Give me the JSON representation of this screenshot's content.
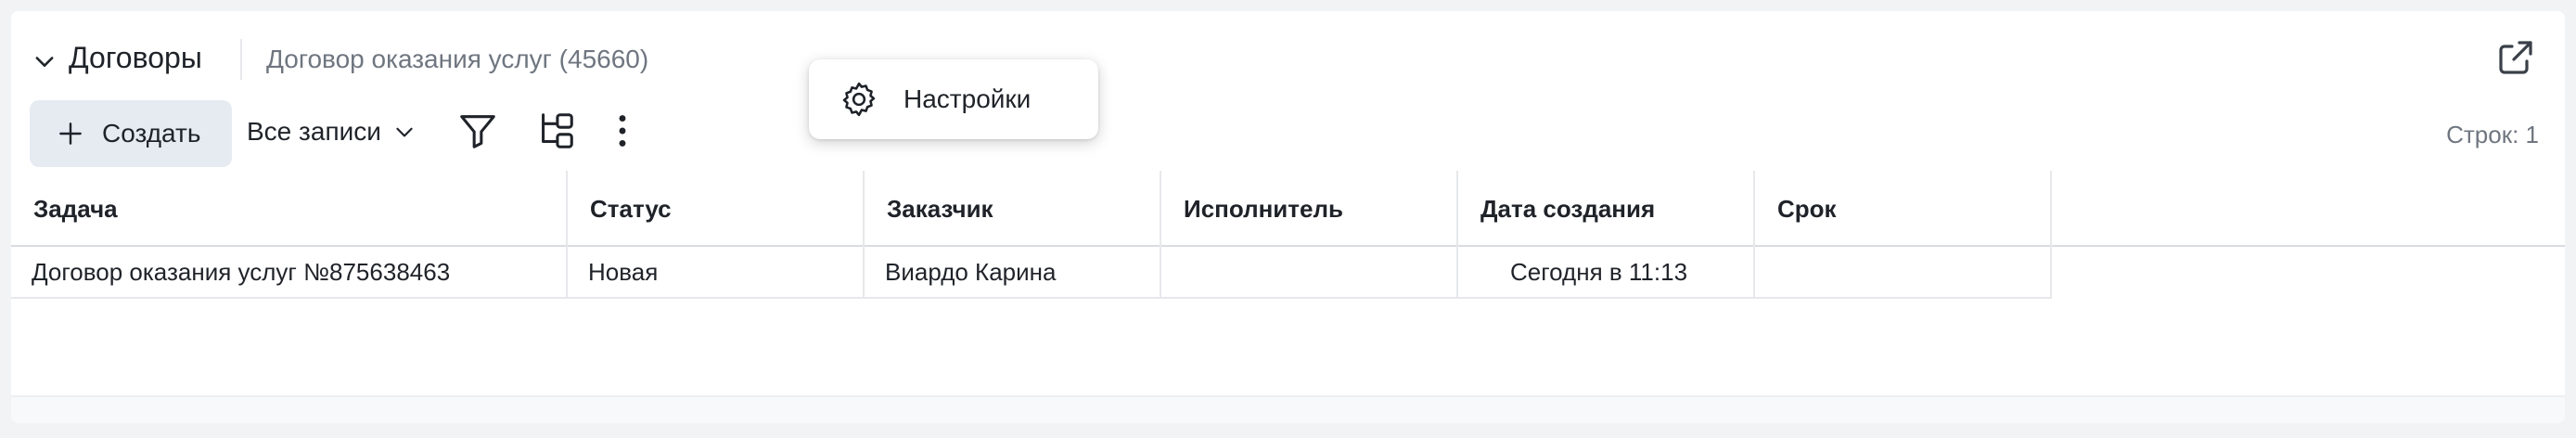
{
  "header": {
    "title": "Договоры",
    "subtitle": "Договор оказания услуг (45660)"
  },
  "toolbar": {
    "create_label": "Создать",
    "view_label": "Все записи",
    "rows_count": "Строк: 1"
  },
  "table": {
    "columns": [
      "Задача",
      "Статус",
      "Заказчик",
      "Исполнитель",
      "Дата создания",
      "Срок"
    ],
    "rows": [
      [
        "Договор оказания услуг №875638463",
        "Новая",
        "Виардо Карина",
        "",
        "Сегодня в 11:13",
        ""
      ]
    ]
  },
  "popup": {
    "settings_label": "Настройки"
  },
  "icons": {
    "collapse": "chevron-down-icon",
    "open_external": "external-link-icon",
    "add": "plus-icon",
    "dropdown": "chevron-down-icon",
    "filter": "filter-icon",
    "grouping": "hierarchy-icon",
    "more": "more-vertical-icon",
    "settings": "gear-icon"
  }
}
